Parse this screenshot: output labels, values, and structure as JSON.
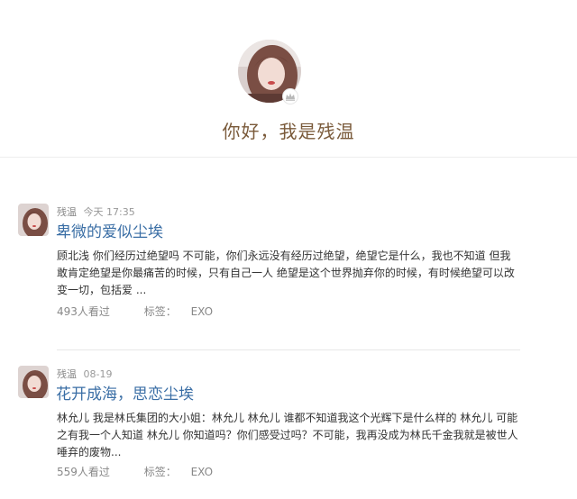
{
  "profile": {
    "name": "你好，我是残温",
    "badge_icon": "crown-icon"
  },
  "posts": [
    {
      "author": "残温",
      "time": "今天 17:35",
      "title": "卑微的爱似尘埃",
      "excerpt": "顾北浅 你们经历过绝望吗 不可能，你们永远没有经历过绝望，绝望它是什么，我也不知道 但我敢肯定绝望是你最痛苦的时候，只有自己一人 绝望是这个世界抛弃你的时候，有时候绝望可以改变一切，包括爱 ...",
      "views": "493人看过",
      "tag_label": "标签：",
      "tag": "EXO"
    },
    {
      "author": "残温",
      "time": "08-19",
      "title": "花开成海，思恋尘埃",
      "excerpt": "林允儿 我是林氏集团的大小姐：林允儿 林允儿 谁都不知道我这个光辉下是什么样的 林允儿 可能之有我一个人知道 林允儿 你知道吗？你们感受过吗？不可能，我再没成为林氏千金我就是被世人唾弃的废物...",
      "views": "559人看过",
      "tag_label": "标签：",
      "tag": "EXO"
    }
  ],
  "colors": {
    "name": "#7a5a3a",
    "title_link": "#3a6ea5",
    "meta": "#999999"
  }
}
